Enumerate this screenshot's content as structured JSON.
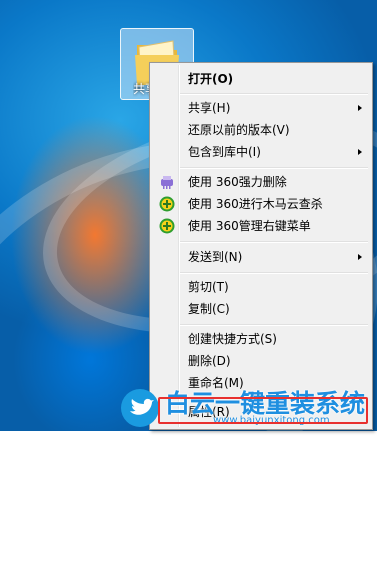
{
  "desktop": {
    "folder_label": "共享"
  },
  "context_menu": {
    "items": [
      {
        "label": "打开(O)"
      },
      {
        "label": "共享(H)"
      },
      {
        "label": "还原以前的版本(V)"
      },
      {
        "label": "包含到库中(I)"
      },
      {
        "label": "使用 360强力删除"
      },
      {
        "label": "使用 360进行木马云查杀"
      },
      {
        "label": "使用 360管理右键菜单"
      },
      {
        "label": "发送到(N)"
      },
      {
        "label": "剪切(T)"
      },
      {
        "label": "复制(C)"
      },
      {
        "label": "创建快捷方式(S)"
      },
      {
        "label": "删除(D)"
      },
      {
        "label": "重命名(M)"
      },
      {
        "label": "属性(R)"
      }
    ]
  },
  "watermark": {
    "title": "白云一键重装系统",
    "url": "www.baiyunxitong.com"
  },
  "colors": {
    "highlight": "#e8302e",
    "watermark": "#1f8fe0"
  }
}
